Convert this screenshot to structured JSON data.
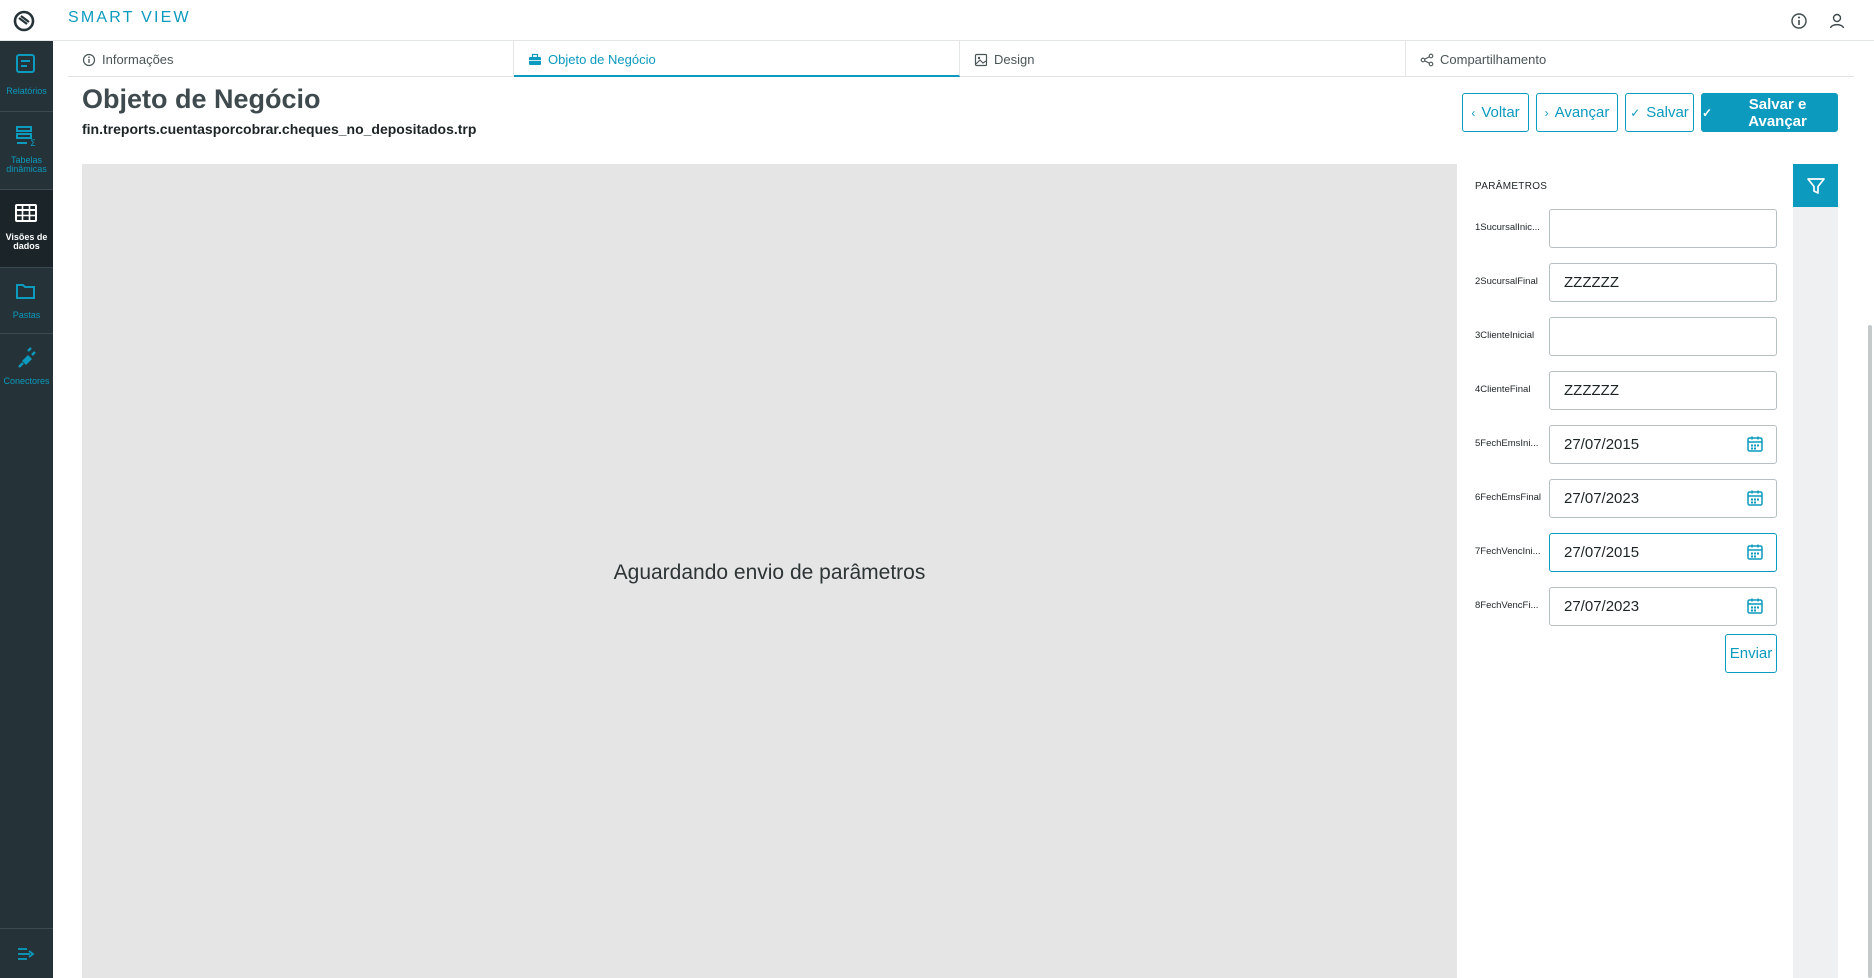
{
  "app": {
    "title": "SMART VIEW",
    "accent_color": "#0c9abe",
    "sidebar_bg": "#253237"
  },
  "topbar": {
    "info_icon": "info-icon",
    "user_icon": "user-icon"
  },
  "sidebar": {
    "items": [
      {
        "label": "Relatórios",
        "icon": "report-icon",
        "active": false
      },
      {
        "label_line1": "Tabelas",
        "label_line2": "dinâmicas",
        "icon": "pivot-table-icon",
        "active": false
      },
      {
        "label_line1": "Visões de",
        "label_line2": "dados",
        "icon": "grid-icon",
        "active": true
      },
      {
        "label": "Pastas",
        "icon": "folder-icon",
        "active": false
      },
      {
        "label": "Conectores",
        "icon": "plug-icon",
        "active": false
      }
    ],
    "toggle_icon": "expand-menu-icon"
  },
  "tabs": [
    {
      "label": "Informações",
      "icon": "info-icon",
      "active": false
    },
    {
      "label": "Objeto de Negócio",
      "icon": "briefcase-icon",
      "active": true
    },
    {
      "label": "Design",
      "icon": "image-icon",
      "active": false
    },
    {
      "label": "Compartilhamento",
      "icon": "share-icon",
      "active": false
    }
  ],
  "header": {
    "title": "Objeto de Negócio",
    "subtitle": "fin.treports.cuentasporcobrar.cheques_no_depositados.trp"
  },
  "actions": {
    "back": "Voltar",
    "next": "Avançar",
    "save": "Salvar",
    "save_next": "Salvar e Avançar"
  },
  "preview": {
    "message": "Aguardando envio de parâmetros"
  },
  "params": {
    "title": "PARÂMETROS",
    "items": [
      {
        "label": "1SucursalInic...",
        "value": "",
        "type": "text"
      },
      {
        "label": "2SucursalFinal",
        "value": "ZZZZZZ",
        "type": "text"
      },
      {
        "label": "3ClienteInicial",
        "value": "",
        "type": "text"
      },
      {
        "label": "4ClienteFinal",
        "value": "ZZZZZZ",
        "type": "text"
      },
      {
        "label": "5FechEmsIni...",
        "value": "27/07/2015",
        "type": "date"
      },
      {
        "label": "6FechEmsFinal",
        "value": "27/07/2023",
        "type": "date"
      },
      {
        "label": "7FechVencIni...",
        "value": "27/07/2015",
        "type": "date",
        "focused": true
      },
      {
        "label": "8FechVencFi...",
        "value": "27/07/2023",
        "type": "date"
      }
    ],
    "submit": "Enviar",
    "filter_icon": "filter-icon"
  }
}
